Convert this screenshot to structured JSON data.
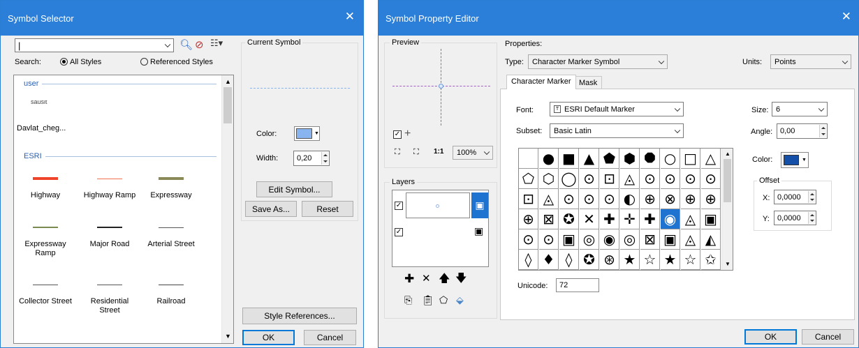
{
  "left": {
    "title": "Symbol Selector",
    "search_value": "",
    "search_label": "Search:",
    "radio_all": "All Styles",
    "radio_ref": "Referenced Styles",
    "group_user": "user",
    "partial_item": "sausit",
    "user_item": "Davlat_cheg...",
    "group_esri": "ESRI",
    "items": [
      {
        "label": "Highway",
        "color": "#f0442a",
        "style": "thick"
      },
      {
        "label": "Highway Ramp",
        "color": "#f07050",
        "style": "thin"
      },
      {
        "label": "Expressway",
        "color": "#8a8a58",
        "style": "thick"
      },
      {
        "label": "Expressway Ramp",
        "color": "#7a8a50",
        "style": "mid"
      },
      {
        "label": "Major Road",
        "color": "#222222",
        "style": "mid"
      },
      {
        "label": "Arterial Street",
        "color": "#555555",
        "style": "thin"
      },
      {
        "label": "Collector Street",
        "color": "#555555",
        "style": "thin"
      },
      {
        "label": "Residential Street",
        "color": "#555555",
        "style": "thin"
      },
      {
        "label": "Railroad",
        "color": "#444444",
        "style": "rail"
      }
    ],
    "current_symbol": "Current Symbol",
    "color_label": "Color:",
    "symbol_color": "#88b4f0",
    "width_label": "Width:",
    "width_value": "0,20",
    "edit_symbol": "Edit Symbol...",
    "save_as": "Save As...",
    "reset": "Reset",
    "style_references": "Style References...",
    "ok": "OK",
    "cancel": "Cancel"
  },
  "right": {
    "title": "Symbol Property Editor",
    "preview_label": "Preview",
    "zoom_value": "100%",
    "layers_label": "Layers",
    "properties_label": "Properties:",
    "type_label": "Type:",
    "type_value": "Character Marker Symbol",
    "units_label": "Units:",
    "units_value": "Points",
    "tab_char": "Character Marker",
    "tab_mask": "Mask",
    "font_label": "Font:",
    "font_value": "ESRI Default Marker",
    "subset_label": "Subset:",
    "subset_value": "Basic Latin",
    "size_label": "Size:",
    "size_value": "6",
    "angle_label": "Angle:",
    "angle_value": "0,00",
    "color_label": "Color:",
    "marker_color": "#1550a8",
    "offset_label": "Offset",
    "x_label": "X:",
    "x_value": "0,0000",
    "y_label": "Y:",
    "y_value": "0,0000",
    "unicode_label": "Unicode:",
    "unicode_value": "72",
    "glyphs": [
      [
        "",
        "●",
        "■",
        "▲",
        "⬟",
        "⬢",
        "⯃",
        "○",
        "□",
        "△"
      ],
      [
        "⬠",
        "⬡",
        "◯",
        "⊙",
        "⊡",
        "◬",
        "⊙",
        "⊙",
        "⊙",
        "⊙"
      ],
      [
        "⊡",
        "◬",
        "⊙",
        "⊙",
        "⊙",
        "◐",
        "⊕",
        "⊗",
        "⊕",
        "⊕"
      ],
      [
        "⊕",
        "⊠",
        "✪",
        "✕",
        "✚",
        "✛",
        "✚",
        "◉",
        "◬",
        "▣"
      ],
      [
        "⊙",
        "⊙",
        "▣",
        "◎",
        "◉",
        "◎",
        "⊠",
        "▣",
        "◬",
        "◭"
      ],
      [
        "◊",
        "♦",
        "◊",
        "✪",
        "⊛",
        "★",
        "☆",
        "★",
        "☆",
        "✩"
      ]
    ],
    "selected_cell": "3-7",
    "ok": "OK",
    "cancel": "Cancel"
  }
}
